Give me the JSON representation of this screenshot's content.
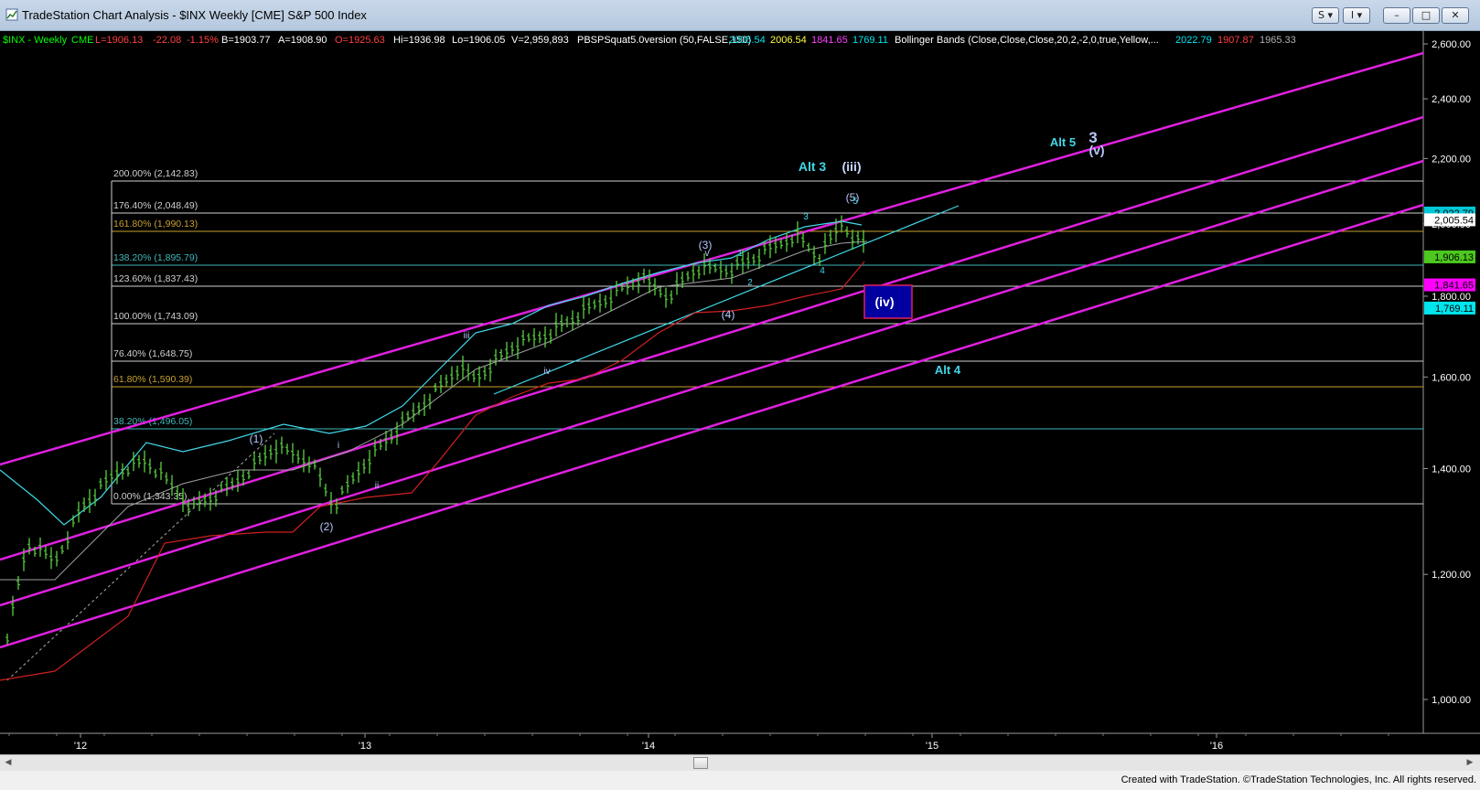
{
  "window": {
    "title": "TradeStation Chart Analysis - $INX Weekly [CME] S&P 500 Index",
    "buttons": {
      "s_label": "S",
      "i_label": "I"
    }
  },
  "header": {
    "symbol": "$INX - Weekly",
    "exchange": "CME",
    "last": "L=1906.13",
    "change": "-22.08",
    "change_pct": "-1.15%",
    "bid": "B=1903.77",
    "ask": "A=1908.90",
    "open": "O=1925.63",
    "high": "Hi=1936.98",
    "low": "Lo=1906.05",
    "volume": "V=2,959,893",
    "study1": "PBSPSquat5.0version (50,FALSE,150)",
    "study1_vals": [
      "2005.54",
      "2006.54",
      "1841.65",
      "1769.11"
    ],
    "study2": "Bollinger Bands (Close,Close,Close,20,2,-2,0,true,Yellow,...",
    "study2_vals": [
      "2022.79",
      "1907.87",
      "1965.33"
    ]
  },
  "price_axis": [
    "2,600.00",
    "2,400.00",
    "2,200.00",
    "2,000.00",
    "1,800.00",
    "1,600.00",
    "1,400.00",
    "1,200.00",
    "1,000.00"
  ],
  "price_markers": [
    {
      "label": "2,022.79",
      "color": "#00c8d8",
      "text_color": "#000000"
    },
    {
      "label": "2,005.54",
      "color": "#ffffff",
      "text_color": "#000000"
    },
    {
      "label": "1,906.13",
      "color": "#4cc81e",
      "text_color": "#000000"
    },
    {
      "label": "1,841.65",
      "color": "#ff00ff",
      "text_color": "#000000"
    },
    {
      "label": "1,769.11",
      "color": "#00e5ee",
      "text_color": "#000000"
    }
  ],
  "time_axis": [
    "'12",
    "'13",
    "'14",
    "'15",
    "'16"
  ],
  "fib_levels": [
    {
      "pct": "200.00%",
      "val": "(2,142.83)",
      "color": "#d0d0d0"
    },
    {
      "pct": "176.40%",
      "val": "(2,048.49)",
      "color": "#d0d0d0"
    },
    {
      "pct": "161.80%",
      "val": "(1,990.13)",
      "color": "#c8a030"
    },
    {
      "pct": "138.20%",
      "val": "(1,895.79)",
      "color": "#40b8b8"
    },
    {
      "pct": "123.60%",
      "val": "(1,837.43)",
      "color": "#d0d0d0"
    },
    {
      "pct": "100.00%",
      "val": "(1,743.09)",
      "color": "#d0d0d0"
    },
    {
      "pct": "76.40%",
      "val": "(1,648.75)",
      "color": "#d0d0d0"
    },
    {
      "pct": "61.80%",
      "val": "(1,590.39)",
      "color": "#c8a030"
    },
    {
      "pct": "38.20%",
      "val": "(1,496.05)",
      "color": "#40b8b8"
    },
    {
      "pct": "0.00%",
      "val": "(1,343.35)",
      "color": "#d0d0d0"
    }
  ],
  "wave_labels": {
    "w1": "(1)",
    "w2": "(2)",
    "w3": "(3)",
    "w4": "(4)",
    "w5": "(5)",
    "wi": "i",
    "wii": "ii",
    "wiii": "iii",
    "wiv": "iv",
    "wv": "v",
    "s1": "1",
    "s2": "2",
    "s3": "3",
    "s4": "4",
    "s5": "5",
    "big_iii": "(iii)",
    "big_iv": "(iv)",
    "big_v": "(v)",
    "big_3": "3",
    "alt3": "Alt 3",
    "alt4": "Alt 4",
    "alt5": "Alt 5"
  },
  "chart_data": {
    "type": "bar",
    "title": "$INX - Weekly",
    "y_scale": "log",
    "ylim": [
      1000,
      2600
    ],
    "x_range": [
      "2011-10",
      "2016-08"
    ],
    "series": [
      {
        "name": "$INX",
        "x": [
          "2011-10",
          "2012-04",
          "2012-06",
          "2012-09",
          "2012-11",
          "2013-05",
          "2013-06",
          "2013-12",
          "2014-02",
          "2014-04",
          "2014-07",
          "2014-08",
          "2014-09",
          "2014-10"
        ],
        "values": [
          1100,
          1420,
          1280,
          1470,
          1350,
          1680,
          1580,
          1840,
          1750,
          1880,
          1990,
          1880,
          2010,
          1906
        ]
      }
    ],
    "channel_lines": 4,
    "grid": false,
    "legend": "top-left"
  },
  "footer": {
    "text": "Created with TradeStation. ©TradeStation Technologies, Inc. All rights reserved."
  }
}
